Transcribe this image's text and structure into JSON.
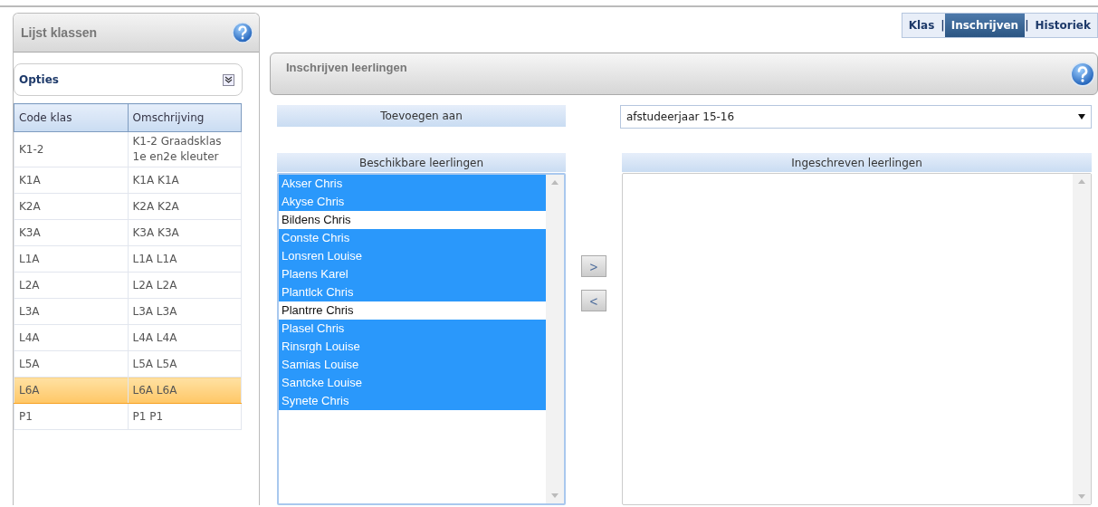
{
  "sidebar": {
    "title": "Lijst klassen",
    "options": {
      "label": "Opties",
      "expanded": false
    },
    "table": {
      "columns": [
        "Code klas",
        "Omschrijving"
      ],
      "rows": [
        {
          "cells": [
            "K1-2",
            "K1-2 Graadsklas 1e en2e kleuter"
          ],
          "selected": false
        },
        {
          "cells": [
            "K1A",
            "K1A K1A"
          ],
          "selected": false
        },
        {
          "cells": [
            "K2A",
            "K2A K2A"
          ],
          "selected": false
        },
        {
          "cells": [
            "K3A",
            "K3A K3A"
          ],
          "selected": false
        },
        {
          "cells": [
            "L1A",
            "L1A L1A"
          ],
          "selected": false
        },
        {
          "cells": [
            "L2A",
            "L2A L2A"
          ],
          "selected": false
        },
        {
          "cells": [
            "L3A",
            "L3A L3A"
          ],
          "selected": false
        },
        {
          "cells": [
            "L4A",
            "L4A L4A"
          ],
          "selected": false
        },
        {
          "cells": [
            "L5A",
            "L5A L5A"
          ],
          "selected": false
        },
        {
          "cells": [
            "L6A",
            "L6A L6A"
          ],
          "selected": true
        },
        {
          "cells": [
            "P1",
            "P1 P1"
          ],
          "selected": false
        }
      ]
    }
  },
  "tabs": [
    {
      "label": "Klas",
      "selected": false
    },
    {
      "label": "Inschrijven",
      "selected": true
    },
    {
      "label": "Historiek",
      "selected": false
    }
  ],
  "tab_separator": "|",
  "panel": {
    "title": "Inschrijven leerlingen",
    "add_to": {
      "label": "Toevoegen aan",
      "value": "afstudeerjaar 15-16"
    },
    "available": {
      "title": "Beschikbare leerlingen",
      "items": [
        {
          "name": "Akser Chris",
          "selected": true
        },
        {
          "name": "Akyse Chris",
          "selected": true
        },
        {
          "name": "Bildens Chris",
          "selected": false
        },
        {
          "name": "Conste Chris",
          "selected": true
        },
        {
          "name": "Lonsren Louise",
          "selected": true
        },
        {
          "name": "Plaens Karel",
          "selected": true
        },
        {
          "name": "Plantlck Chris",
          "selected": true
        },
        {
          "name": "Plantrre Chris",
          "selected": false
        },
        {
          "name": "Plasel Chris",
          "selected": true
        },
        {
          "name": "Rinsrgh Louise",
          "selected": true
        },
        {
          "name": "Samias Louise",
          "selected": true
        },
        {
          "name": "Santcke Louise",
          "selected": true
        },
        {
          "name": "Synete Chris",
          "selected": true
        }
      ]
    },
    "move_buttons": [
      ">",
      "<"
    ],
    "enrolled": {
      "title": "Ingeschreven leerlingen"
    }
  }
}
